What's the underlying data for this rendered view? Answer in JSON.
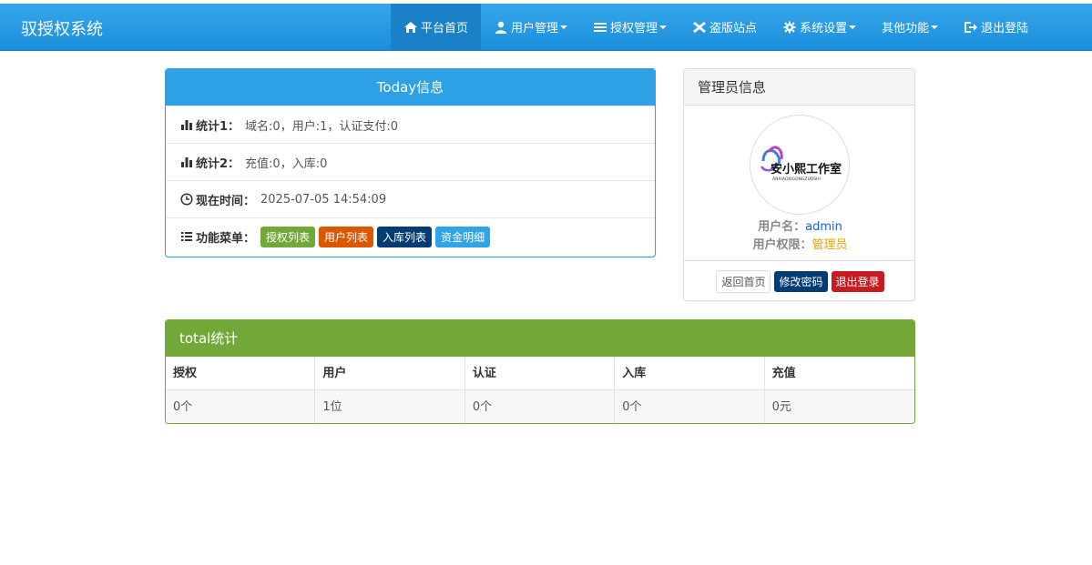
{
  "app": {
    "title": "驭授权系统"
  },
  "nav": {
    "items": [
      {
        "label": "平台首页",
        "icon": "home-icon",
        "active": true,
        "dropdown": false
      },
      {
        "label": "用户管理",
        "icon": "user-icon",
        "active": false,
        "dropdown": true
      },
      {
        "label": "授权管理",
        "icon": "list-icon",
        "active": false,
        "dropdown": true
      },
      {
        "label": "盗版站点",
        "icon": "close-icon",
        "active": false,
        "dropdown": false
      },
      {
        "label": "系统设置",
        "icon": "gear-icon",
        "active": false,
        "dropdown": true
      },
      {
        "label": "其他功能",
        "icon": "",
        "active": false,
        "dropdown": true
      },
      {
        "label": "退出登陆",
        "icon": "logout-icon",
        "active": false,
        "dropdown": false
      }
    ]
  },
  "today": {
    "title": "Today信息",
    "stat1": {
      "label": "统计1：",
      "value": "域名:0，用户:1，认证支付:0"
    },
    "stat2": {
      "label": "统计2：",
      "value": "充值:0，入库:0"
    },
    "time": {
      "label": "现在时间：",
      "value": "2025-07-05 14:54:09"
    },
    "menu": {
      "label": "功能菜单：",
      "buttons": [
        {
          "label": "授权列表",
          "color": "#73a839"
        },
        {
          "label": "用户列表",
          "color": "#dd5600"
        },
        {
          "label": "入库列表",
          "color": "#033c73"
        },
        {
          "label": "资金明细",
          "color": "#2fa4e7"
        }
      ]
    }
  },
  "admin": {
    "title": "管理员信息",
    "avatar_text": "安小熙工作室",
    "avatar_sub": "ANXIAOXIGONGZUOSHI",
    "username_label": "用户名：",
    "username": "admin",
    "role_label": "用户权限：",
    "role": "管理员",
    "buttons": {
      "home": "返回首页",
      "password": "修改密码",
      "logout": "退出登录"
    }
  },
  "total": {
    "title": "total统计",
    "headers": [
      "授权",
      "用户",
      "认证",
      "入库",
      "充值"
    ],
    "values": [
      "0个",
      "1位",
      "0个",
      "0个",
      "0元"
    ]
  },
  "colors": {
    "primary": "#2fa4e7",
    "success": "#73a839",
    "warning": "#dd5600",
    "dark": "#033c73",
    "danger": "#c71c22",
    "link": "#2fa4e7",
    "role": "#e8a100"
  }
}
